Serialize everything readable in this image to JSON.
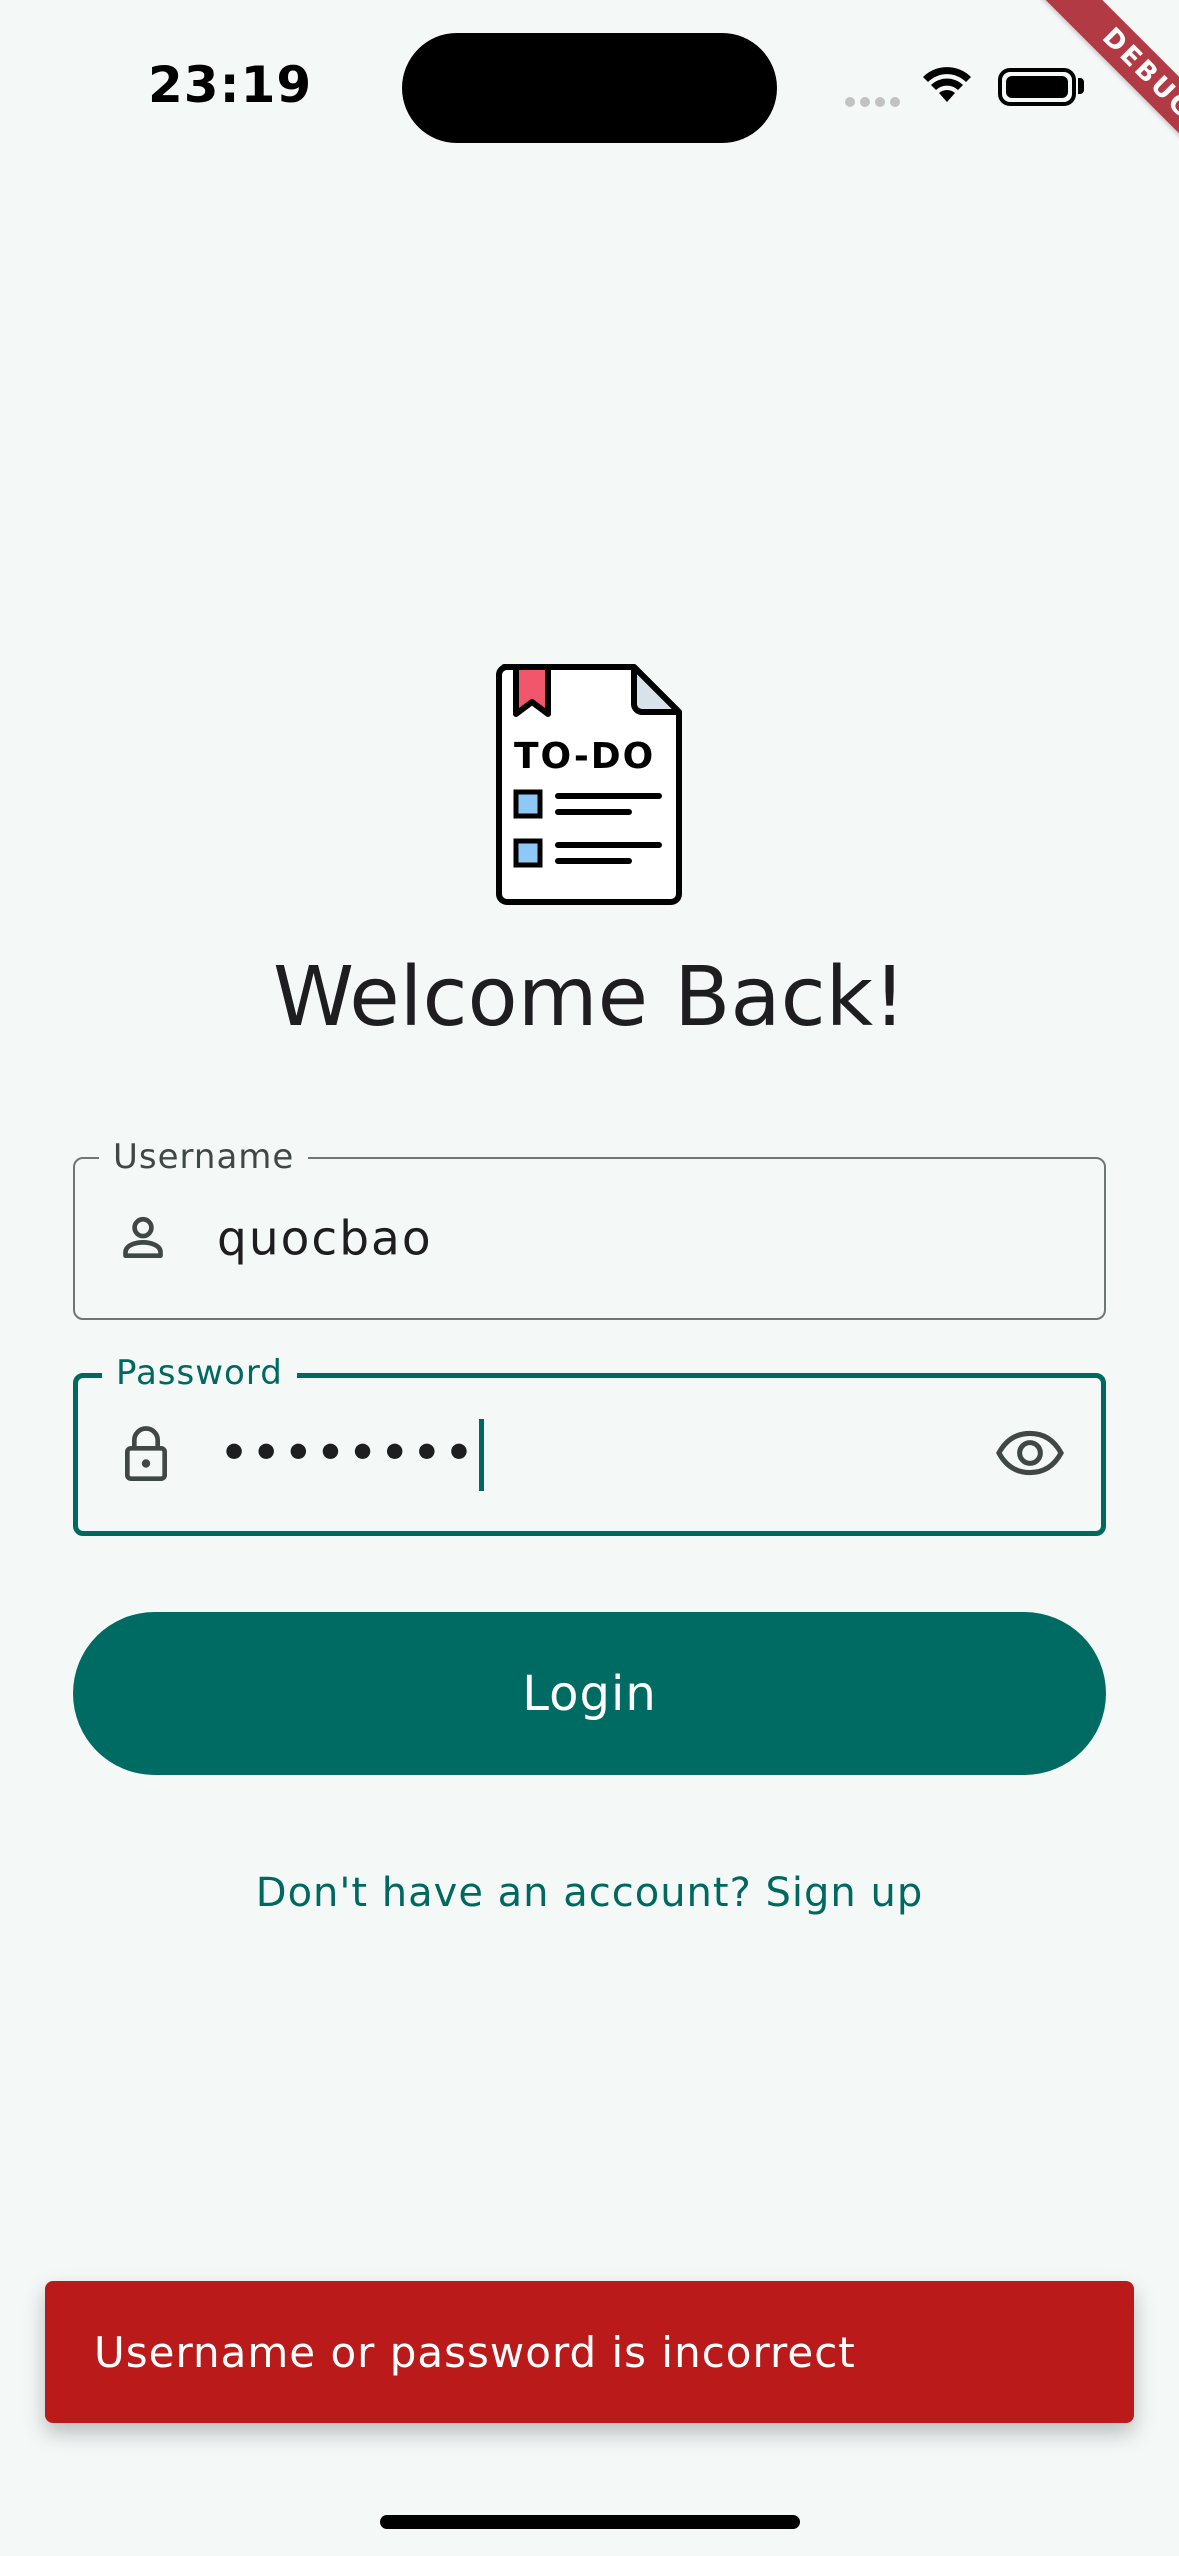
{
  "status_bar": {
    "time": "23:19",
    "wifi_icon": "wifi-icon",
    "battery_icon": "battery-full-icon"
  },
  "debug_banner": {
    "label": "DEBUG"
  },
  "logo": {
    "icon": "todo-document-icon",
    "text": "TO-DO"
  },
  "title": "Welcome Back!",
  "username": {
    "label": "Username",
    "value": "quocbao",
    "icon": "person-icon"
  },
  "password": {
    "label": "Password",
    "value": "••••••••",
    "icon": "lock-icon",
    "toggle_icon": "eye-icon"
  },
  "login_button": {
    "label": "Login"
  },
  "signup_link": {
    "label": "Don't have an account? Sign up"
  },
  "snackbar": {
    "message": "Username or password is incorrect"
  },
  "colors": {
    "primary": "#00695f",
    "background": "#f4f9f8",
    "error": "#ba1a1a",
    "logo_accent_red": "#f2566a",
    "logo_accent_blue": "#8ec9f5"
  }
}
